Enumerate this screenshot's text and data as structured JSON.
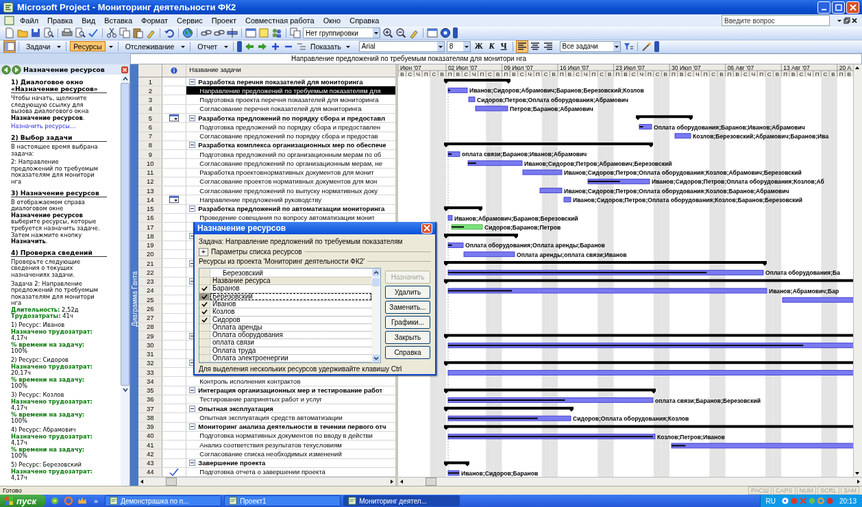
{
  "window": {
    "title": "Microsoft Project - Мониторинг деятельности ФК2"
  },
  "menu": [
    "Файл",
    "Правка",
    "Вид",
    "Вставка",
    "Формат",
    "Сервис",
    "Проект",
    "Совместная работа",
    "Окно",
    "Справка"
  ],
  "help_box": {
    "placeholder": "Введите вопрос"
  },
  "toolbar": {
    "grouping": "Нет группировки"
  },
  "guide_toolbar": {
    "tabs": [
      {
        "label": "Задачи",
        "selected": false
      },
      {
        "label": "Ресурсы",
        "selected": true
      },
      {
        "label": "Отслеживание",
        "selected": false
      },
      {
        "label": "Отчет",
        "selected": false
      }
    ],
    "show": "Показать",
    "font": "Arial",
    "size": "8",
    "bold": "Ж",
    "italic": "К",
    "underline": "Ч",
    "align": [
      {
        "kind": "left",
        "selected": true
      },
      {
        "kind": "center",
        "selected": false
      },
      {
        "kind": "right",
        "selected": false
      }
    ],
    "filter": "Все задачи"
  },
  "entry_bar": {
    "value": "Направление предложений по требуемым показателям для монитори нга"
  },
  "task_pane": {
    "title": "Назначение ресурсов",
    "blocks": [
      {
        "kind": "heading",
        "text": "1) Диалоговое окно «Назначение ресурсов»"
      },
      {
        "kind": "text",
        "text": "Чтобы начать, щелкните следующую ссылку для вызова диалогового окна **Назначение ресурсов**."
      },
      {
        "kind": "link",
        "text": "Назначить ресурсы..."
      },
      {
        "kind": "heading",
        "text": "2) Выбор задачи"
      },
      {
        "kind": "text",
        "text": "В настоящее время выбрана задача:"
      },
      {
        "kind": "text",
        "text": "2: Направление предложений по требуемым показателям для монитори нга"
      },
      {
        "kind": "heading",
        "text": "3) Назначение ресурсов"
      },
      {
        "kind": "text",
        "text": "В отображаемом справа диалоговом окне **Назначение ресурсов** выберите ресурсы, которые требуется назначить задаче. Затем нажмите кнопку **Назначить**."
      },
      {
        "kind": "heading",
        "text": "4) Проверка сведений"
      },
      {
        "kind": "text",
        "text": "Проверьте следующие сведения о текущих назначениях задачи."
      },
      {
        "kind": "text",
        "text": "Задача 2: Направление предложений по требуемым показателям для монитори нга"
      },
      {
        "kind": "metric",
        "label": "Длительность:",
        "value": "2,52д"
      },
      {
        "kind": "metric",
        "label": "Трудозатраты:",
        "value": "41ч"
      },
      {
        "kind": "text",
        "text": "1) Ресурс: Иванов"
      },
      {
        "kind": "metric",
        "label": "Назначено трудозатрат:",
        "value": "4,17ч"
      },
      {
        "kind": "metric",
        "label": "% времени на задачу:",
        "value": "100%"
      },
      {
        "kind": "text",
        "text": "2) Ресурс: Сидоров"
      },
      {
        "kind": "metric",
        "label": "Назначено трудозатрат:",
        "value": "20,17ч"
      },
      {
        "kind": "metric",
        "label": "% времени на задачу:",
        "value": "100%"
      },
      {
        "kind": "text",
        "text": "3) Ресурс: Козлов"
      },
      {
        "kind": "metric",
        "label": "Назначено трудозатрат:",
        "value": "4,17ч"
      },
      {
        "kind": "metric",
        "label": "% времени на задачу:",
        "value": "100%"
      },
      {
        "kind": "text",
        "text": "4) Ресурс: Абрамович"
      },
      {
        "kind": "metric",
        "label": "Назначено трудозатрат:",
        "value": "4,17ч"
      },
      {
        "kind": "metric",
        "label": "% времени на задачу:",
        "value": "100%"
      },
      {
        "kind": "text",
        "text": "5) Ресурс: Березовский"
      },
      {
        "kind": "metric",
        "label": "Назначено трудозатрат:",
        "value": "4,17ч"
      }
    ]
  },
  "view_bar": {
    "label": "Диаграмма Ганта"
  },
  "table": {
    "columns": [
      "Название задачи"
    ],
    "rows": [
      {
        "id": "1",
        "kind": "summary",
        "name": "Разработка перечня показателей для мониторинга",
        "selected": false,
        "bar": {
          "kind": "summary"
        }
      },
      {
        "id": "2",
        "kind": "task",
        "name": "Направление предложений по требуемым показателям для",
        "selected": true,
        "bar": {
          "kind": "task",
          "label": "Иванов;Сидоров;Абрамович;Баранов;Березовский;Козлов",
          "level": 0.1
        }
      },
      {
        "id": "3",
        "kind": "task",
        "name": "Подготовка проекта перечня показателей для мониторинга",
        "selected": false,
        "bar": {
          "kind": "task",
          "label": "Сидоров;Петров;Оплата оборудования;Абрамович"
        }
      },
      {
        "id": "4",
        "kind": "task",
        "name": "Согласование перечня показателей для мониторинга",
        "selected": false,
        "bar": {
          "kind": "task",
          "label": "Петров;Баранов;Абрамович"
        }
      },
      {
        "id": "5",
        "kind": "summary",
        "indicator": {
          "kind": "calendar"
        },
        "name": "Разработка предложений по порядку сбора и предоставл",
        "selected": false,
        "bar": {
          "kind": "summary"
        }
      },
      {
        "id": "6",
        "kind": "task",
        "name": "Подготовка предложений по порядку сбора и предоставлен",
        "selected": false,
        "bar": {
          "kind": "task",
          "label": "Оплата оборудования;Баранов;Иванов;Абрамович",
          "level": 0.3
        }
      },
      {
        "id": "7",
        "kind": "task",
        "name": "Согласование предложений по порядку сбора и предостав",
        "selected": false,
        "bar": {
          "kind": "task",
          "label": "Козлов;Березовский;Абрамович;Баранов;Ива"
        }
      },
      {
        "id": "8",
        "kind": "summary",
        "name": "Разработка комплекса организационных мер по обеспече",
        "selected": false,
        "bar": {
          "kind": "summary"
        }
      },
      {
        "id": "9",
        "kind": "task",
        "name": "Подготовка предложений по организационным мерам по об",
        "selected": false,
        "bar": {
          "kind": "task",
          "label": "оплата связи;Баранов;Иванов;Абрамович",
          "level": 0.3
        }
      },
      {
        "id": "10",
        "kind": "task",
        "name": "Согласование предложений по организационным мерам, не",
        "selected": false,
        "bar": {
          "kind": "task",
          "label": "Иванов;Сидоров;Петров;Абрамович;Березовский",
          "level": 0.15
        }
      },
      {
        "id": "11",
        "kind": "task",
        "name": "Разработка проектовнормативных документов для монит",
        "selected": false,
        "bar": {
          "kind": "task",
          "label": "Иванов;Сидоров;Петров;Оплата оборудования;Козлов;Абрамович;Березовский"
        }
      },
      {
        "id": "12",
        "kind": "task",
        "name": "Согласование проектов нормативных документов для мон",
        "selected": false,
        "bar": {
          "kind": "task",
          "label": "Иванов;Сидоров;Петров;Оплата оборудования;Козлов;Аб",
          "level": 0.52
        }
      },
      {
        "id": "13",
        "kind": "task",
        "name": "Согласование предложений по выпуску нормативных доку",
        "selected": false,
        "bar": {
          "kind": "task",
          "label": "Иванов;Сидоров;Петров;Оплата оборудования;Козлов;Баранов;Абрамович"
        }
      },
      {
        "id": "14",
        "kind": "task",
        "indicator": {
          "kind": "calendar"
        },
        "name": "Направление предложений руководству",
        "selected": false,
        "bar": {
          "kind": "task",
          "label": "Иванов;Сидоров;Петров;Оплата оборудования;Козлов;Баранов;Березовский"
        }
      },
      {
        "id": "15",
        "kind": "summary",
        "name": "Разработка предложений по автоматизации мониторинга",
        "selected": false,
        "bar": {
          "kind": "summary"
        }
      },
      {
        "id": "16",
        "kind": "task",
        "name": "Проведение совещания по вопросу автоматизации монит",
        "selected": false,
        "bar": {
          "kind": "task",
          "label": "Иванов;Абрамович;Баранов;Березовский"
        }
      },
      {
        "id": "17",
        "kind": "task",
        "selected": false,
        "bar": {
          "kind": "marked",
          "label": "Сидоров;Баранов;Петров",
          "level": 0.4
        }
      },
      {
        "id": "18",
        "kind": "summary",
        "selected": false,
        "bar": {
          "kind": "summary"
        }
      },
      {
        "id": "19",
        "kind": "task",
        "selected": false,
        "bar": {
          "kind": "task",
          "label": "Оплата оборудования;Оплата аренды;Баранов",
          "level": 0.25
        }
      },
      {
        "id": "20",
        "kind": "task",
        "selected": false,
        "bar": {
          "kind": "task",
          "label": "Оплата аренды;оплата связи;Иванов"
        }
      },
      {
        "id": "21",
        "kind": "summary",
        "selected": false,
        "bar": {
          "kind": "summary"
        }
      },
      {
        "id": "22",
        "kind": "task",
        "selected": false,
        "bar": {
          "kind": "task",
          "label": "Оплата оборудования;Ба",
          "level": 0.82
        }
      },
      {
        "id": "23",
        "kind": "summary",
        "selected": false,
        "bar": {
          "kind": "summary"
        }
      },
      {
        "id": "24",
        "kind": "task",
        "selected": false,
        "bar": {
          "kind": "task",
          "label": "Иванов;Абрамович;Бар",
          "level": 0.2
        }
      },
      {
        "id": "25",
        "kind": "task",
        "selected": false,
        "bar": {
          "kind": "task"
        }
      },
      {
        "id": "26",
        "kind": "task",
        "selected": false
      },
      {
        "id": "27",
        "kind": "task",
        "selected": false
      },
      {
        "id": "28",
        "kind": "task",
        "selected": false
      },
      {
        "id": "29",
        "kind": "summary",
        "selected": false,
        "bar": {
          "kind": "summary"
        }
      },
      {
        "id": "30",
        "kind": "task",
        "selected": false,
        "bar": {
          "kind": "task",
          "level": 0.84
        }
      },
      {
        "id": "31",
        "kind": "task",
        "selected": false
      },
      {
        "id": "32",
        "kind": "summary",
        "selected": false,
        "bar": {
          "kind": "summary"
        }
      },
      {
        "id": "33",
        "kind": "task",
        "selected": false,
        "bar": {
          "kind": "task"
        }
      },
      {
        "id": "34",
        "kind": "task",
        "name": "Контроль исполнения контрактов",
        "selected": false
      },
      {
        "id": "35",
        "kind": "summary",
        "name": "Интеграция организационных мер и тестирование работ",
        "selected": false,
        "bar": {
          "kind": "summary"
        }
      },
      {
        "id": "36",
        "kind": "task",
        "name": "Тестирование рапринятых работ и услуг",
        "selected": false,
        "bar": {
          "kind": "task",
          "label": "оплата связи;Баранов;Березовский",
          "level": 0.57
        }
      },
      {
        "id": "37",
        "kind": "summary",
        "name": "Опытная эксплуатация",
        "selected": false,
        "bar": {
          "kind": "summary"
        }
      },
      {
        "id": "38",
        "kind": "task",
        "name": "Опытная эксплуатация средств автоматизации",
        "selected": false,
        "bar": {
          "kind": "task",
          "label": "Сидоров;Оплата оборудования;Козлов",
          "level": 0.73
        }
      },
      {
        "id": "39",
        "kind": "summary",
        "name": "Мониторинг анализа деятельности в течении первого отч",
        "selected": false,
        "bar": {
          "kind": "summary"
        }
      },
      {
        "id": "40",
        "kind": "task",
        "name": "Подготовка нормативных документов по вводу в действи",
        "selected": false,
        "bar": {
          "kind": "task",
          "label": "Козлов;Петров;Иванов",
          "level": 0.99
        }
      },
      {
        "id": "41",
        "kind": "task",
        "name": "Анализ соответствия результатов техусловиям",
        "selected": false,
        "bar": {
          "kind": "task",
          "level": 0.07
        }
      },
      {
        "id": "42",
        "kind": "task",
        "name": "Согласование списка необходимых изменений",
        "selected": false
      },
      {
        "id": "43",
        "kind": "summary",
        "name": "Завершение проекта",
        "selected": false,
        "bar": {
          "kind": "summary"
        }
      },
      {
        "id": "44",
        "kind": "task",
        "indicator": {
          "kind": "done"
        },
        "name": "Подготовка отчета о завершении проекта",
        "selected": false,
        "bar": {
          "kind": "task",
          "label": "Иванов;Сидоров;Баранов",
          "level": 1
        }
      }
    ]
  },
  "timescale": {
    "weeks": [
      {
        "label": "Июн '07",
        "days": [
          "В",
          "С",
          "Ч",
          "П",
          "С",
          "В"
        ]
      },
      {
        "label": "02 Июл '07",
        "days": [
          "П",
          "В",
          "С",
          "Ч",
          "П",
          "С",
          "В"
        ]
      },
      {
        "label": "09 Июл '07",
        "days": [
          "П",
          "В",
          "С",
          "Ч",
          "П",
          "С",
          "В"
        ]
      },
      {
        "label": "16 Июл '07",
        "days": [
          "П",
          "В",
          "С",
          "Ч",
          "П",
          "С",
          "В"
        ]
      },
      {
        "label": "23 Июл '07",
        "days": [
          "П",
          "В",
          "С",
          "Ч",
          "П",
          "С",
          "В"
        ]
      },
      {
        "label": "30 Июл '07",
        "days": [
          "П",
          "В",
          "С",
          "Ч",
          "П",
          "С",
          "В"
        ]
      },
      {
        "label": "06 Авг '07",
        "days": [
          "П",
          "В",
          "С",
          "Ч",
          "П",
          "С",
          "В"
        ]
      },
      {
        "label": "13 Авг '07",
        "days": [
          "П",
          "В",
          "С",
          "Ч",
          "П",
          "С",
          "В"
        ]
      },
      {
        "label": "20 А",
        "days": [
          "П",
          "В"
        ]
      }
    ]
  },
  "dialog": {
    "title": "Назначение ресурсов",
    "task": "Задача: Направление предложений по требуемым показателям",
    "options": "Параметры списка ресурсов",
    "options_toggle": "+",
    "source": "Ресурсы из проекта 'Мониторинг деятельности ФК2'",
    "edit_value": "Березовский",
    "column": "Название ресурса",
    "resources": [
      {
        "name": "Баранов",
        "checked": true,
        "selected": false
      },
      {
        "name": "Березовский",
        "checked": true,
        "selected": true
      },
      {
        "name": "Иванов",
        "checked": true,
        "selected": false
      },
      {
        "name": "Козлов",
        "checked": true,
        "selected": false
      },
      {
        "name": "Сидоров",
        "checked": true,
        "selected": false
      },
      {
        "name": "Оплата аренды",
        "checked": false,
        "selected": false
      },
      {
        "name": "Оплата оборудования",
        "checked": false,
        "selected": false
      },
      {
        "name": "оплата связи",
        "checked": false,
        "selected": false
      },
      {
        "name": "Оплата труда",
        "checked": false,
        "selected": false
      },
      {
        "name": "Оплата электроенергии",
        "checked": false,
        "selected": false
      }
    ],
    "buttons": [
      {
        "label": "Назначить",
        "disabled": true
      },
      {
        "label": "Удалить",
        "disabled": false
      },
      {
        "label": "Заменить...",
        "disabled": false
      },
      {
        "label": "Графики...",
        "disabled": false
      },
      {
        "label": "Закрыть",
        "disabled": false
      },
      {
        "label": "Справка",
        "disabled": false
      }
    ],
    "hint": "Для выделения нескольких ресурсов удерживайте клавишу Ctrl"
  },
  "status_bar": {
    "text": "Готово",
    "indicators": [
      {
        "label": "РАСШ",
        "on": false
      },
      {
        "label": "CAPS",
        "on": false
      },
      {
        "label": "NUM",
        "on": false
      },
      {
        "label": "SCRL",
        "on": false
      },
      {
        "label": "ЗАМ",
        "on": false
      }
    ]
  },
  "taskbar": {
    "start": "пуск",
    "more": "»",
    "tasks": [
      {
        "label": "Демонстрашка по п...",
        "selected": false
      },
      {
        "label": "Проект1",
        "selected": false
      },
      {
        "label": "Мониторинг деятел...",
        "selected": true
      }
    ],
    "language": "RU",
    "clock": "20:13"
  }
}
